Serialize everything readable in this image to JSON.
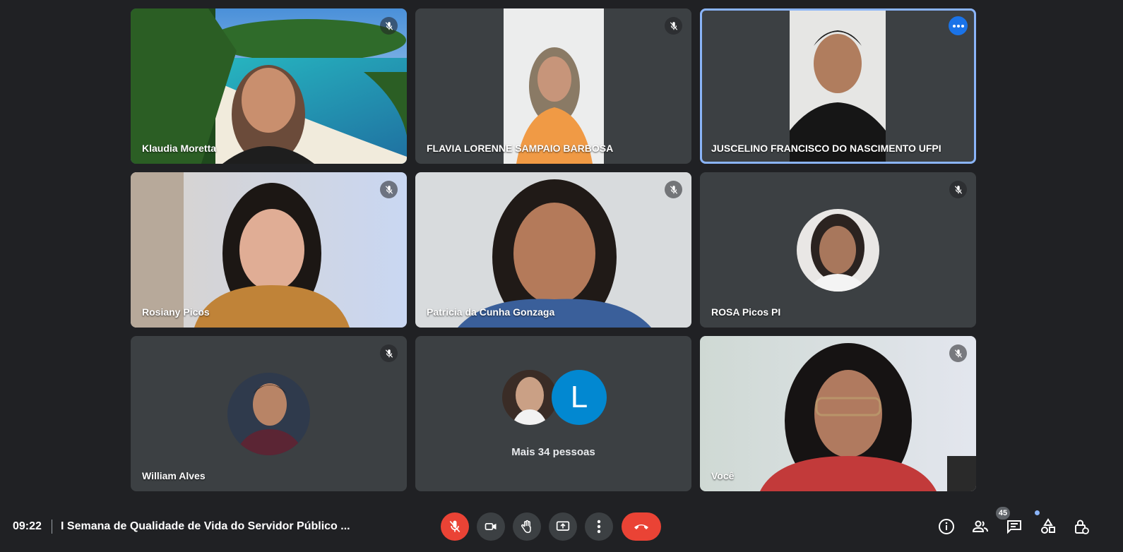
{
  "participants": [
    {
      "name": "Klaudia Moretta"
    },
    {
      "name": "FLAVIA LORENNE SAMPAIO BARBOSA"
    },
    {
      "name": "JUSCELINO FRANCISCO DO NASCIMENTO UFPI"
    },
    {
      "name": "Rosiany Picos"
    },
    {
      "name": "Patricia da Cunha Gonzaga"
    },
    {
      "name": "ROSA Picos PI"
    },
    {
      "name": "William Alves"
    },
    {
      "name": "Você"
    }
  ],
  "overflow_tile": {
    "label": "Mais 34 pessoas",
    "initial": "L"
  },
  "bottom_bar": {
    "time": "09:22",
    "meeting_title": "I Semana de Qualidade de Vida do Servidor Público ...",
    "participants_count": "45"
  },
  "colors": {
    "background": "#202124",
    "tile": "#3c4043",
    "active_outline": "#8ab4f8",
    "danger": "#ea4335",
    "accent_blue": "#1a73e8"
  },
  "icons": [
    "mic-off-icon",
    "more-options-icon",
    "camera-icon",
    "raise-hand-icon",
    "present-screen-icon",
    "more-vert-icon",
    "hang-up-icon",
    "info-icon",
    "people-icon",
    "chat-icon",
    "activities-icon",
    "host-controls-icon"
  ]
}
